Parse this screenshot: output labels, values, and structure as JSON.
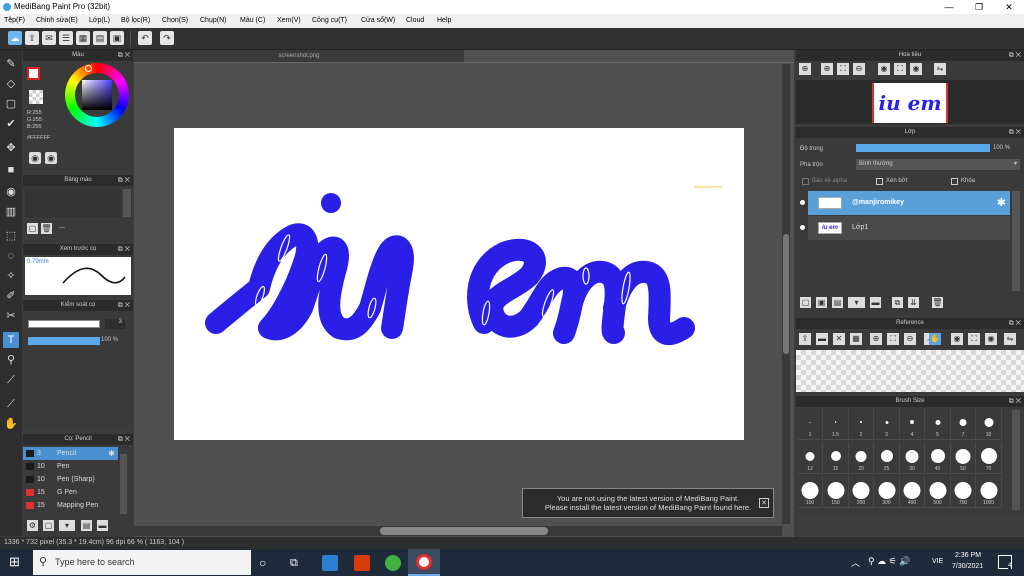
{
  "window": {
    "title": "MediBang Paint Pro (32bit)",
    "minimize": "—",
    "maximize": "❐",
    "close": "✕"
  },
  "menu": [
    "Tệp(F)",
    "Chỉnh sửa(E)",
    "Lớp(L)",
    "Bộ lọc(R)",
    "Chọn(S)",
    "Chụp(N)",
    "Màu (C)",
    "Xem(V)",
    "Công cụ(T)",
    "Cửa sổ(W)",
    "Cloud",
    "Help"
  ],
  "document": {
    "tab_name": "screenshot.png"
  },
  "color_panel": {
    "title": "Màu",
    "rgb_r": "R:255",
    "rgb_g": "G:255",
    "rgb_b": "B:255",
    "hex": "#FFFFFF"
  },
  "palette_panel": {
    "title": "Bảng màu",
    "value": "---"
  },
  "preview_panel": {
    "title": "Xem trước cọ",
    "size": "0.79mm"
  },
  "brush_control": {
    "title": "Kiểm soát cọ",
    "size_value": "3",
    "opacity_value": "100 %"
  },
  "brush_list": {
    "title": "Cọ: Pencil",
    "items": [
      {
        "size": "3",
        "name": "Pencil",
        "color": "#1a1a1a",
        "selected": true
      },
      {
        "size": "10",
        "name": "Pen",
        "color": "#1a1a1a",
        "selected": false
      },
      {
        "size": "10",
        "name": "Pen (Sharp)",
        "color": "#1a1a1a",
        "selected": false
      },
      {
        "size": "15",
        "name": "G Pen",
        "color": "#e03030",
        "selected": false
      },
      {
        "size": "15",
        "name": "Mapping Pen",
        "color": "#e03030",
        "selected": false
      }
    ]
  },
  "navigator": {
    "title": "Hoa tiêu",
    "thumb_text": "iu em"
  },
  "layer_panel": {
    "title": "Lớp",
    "opacity_label": "Độ trong",
    "opacity_value": "100 %",
    "opacity_fraction": 1.0,
    "blend_label": "Pha trộn",
    "blend_value": "Bình thường",
    "protect_alpha": "Bảo vệ alpha",
    "clipping": "Xén bớt",
    "lock": "Khóa",
    "layers": [
      {
        "name": "@manjiromikey",
        "selected": true
      },
      {
        "name": "Lớp1",
        "selected": false
      }
    ]
  },
  "reference_panel": {
    "title": "Reference"
  },
  "brush_size_panel": {
    "title": "Brush Size",
    "sizes": [
      "1",
      "1.5",
      "2",
      "3",
      "4",
      "5",
      "7",
      "10",
      "12",
      "15",
      "20",
      "25",
      "30",
      "40",
      "50",
      "70",
      "100",
      "150",
      "200",
      "300",
      "400",
      "500",
      "700",
      "1000"
    ]
  },
  "canvas": {
    "text": "iu em",
    "stroke_color": "#2a1fe6",
    "signature": "@manjiromikey"
  },
  "notification": {
    "line1": "You are not using the latest version of MediBang Paint.",
    "line2": "Please install the latest version of MediBang Paint found here.",
    "close": "✕"
  },
  "status": "1336 * 732 pixel   (35.3 * 19.4cm)   96 dpi   66 %   ( 1163, 104 )",
  "taskbar": {
    "search_placeholder": "Type here to search",
    "time": "2:36 PM",
    "date": "7/30/2021",
    "lang": "VIE",
    "notif_count": "4"
  },
  "colors": {
    "accent": "#4a8fd0",
    "ink": "#2a1fe6",
    "panel": "#3a3a3a"
  }
}
